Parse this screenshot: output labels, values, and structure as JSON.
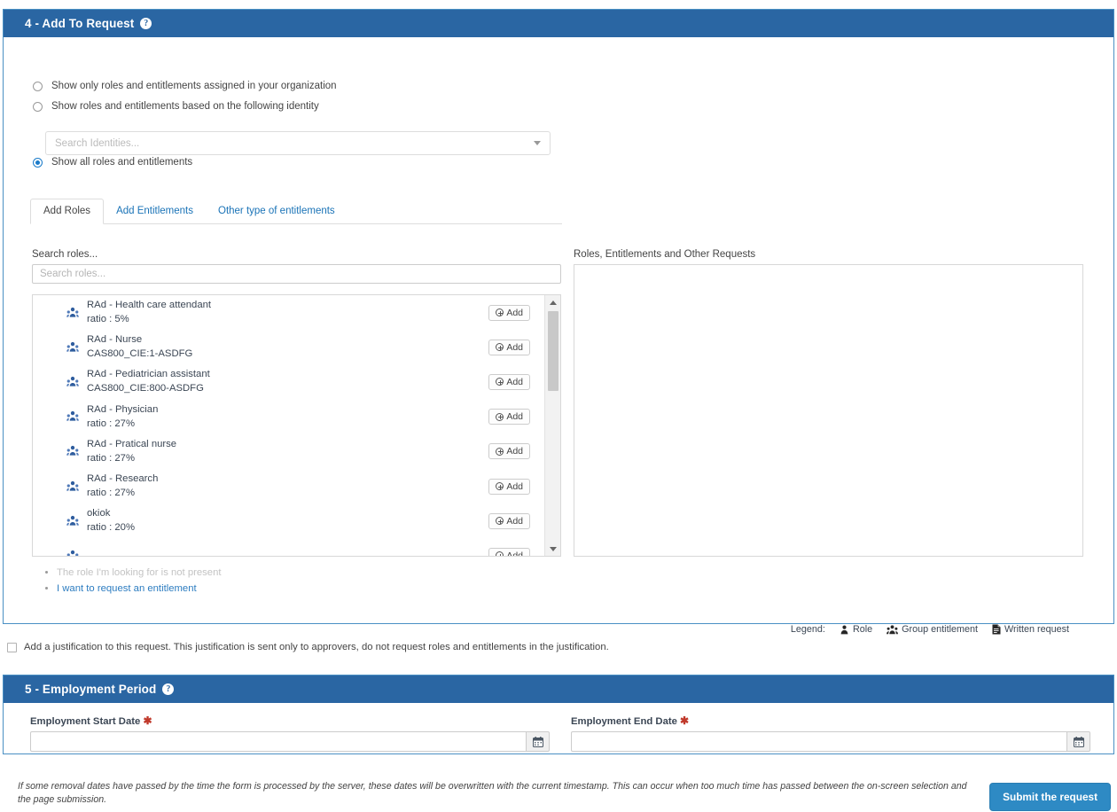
{
  "section4": {
    "title": "4 - Add To Request",
    "help_icon": "help-circle-icon",
    "scope_options": [
      {
        "label": "Show only roles and entitlements assigned in your organization",
        "selected": false
      },
      {
        "label": "Show roles and entitlements based on the following identity",
        "selected": false
      },
      {
        "label": "Show all roles and entitlements",
        "selected": true
      }
    ],
    "identity_select": {
      "placeholder": "Search Identities...",
      "value": "",
      "caret_icon": "chevron-down-icon"
    },
    "tabs": [
      {
        "label": "Add Roles",
        "active": true
      },
      {
        "label": "Add Entitlements",
        "active": false
      },
      {
        "label": "Other type of entitlements",
        "active": false
      }
    ],
    "left_column": {
      "label": "Search roles...",
      "search_placeholder": "Search roles...",
      "search_value": "",
      "add_button_label": "Add",
      "add_button_icon": "plus-circle-icon",
      "row_icon": "group-entitlement-icon",
      "roles": [
        {
          "name": "RAd - Health care attendant",
          "detail": "ratio : 5%"
        },
        {
          "name": "RAd - Nurse",
          "detail": "CAS800_CIE:1-ASDFG"
        },
        {
          "name": "RAd - Pediatrician assistant",
          "detail": "CAS800_CIE:800-ASDFG"
        },
        {
          "name": "RAd - Physician",
          "detail": "ratio : 27%"
        },
        {
          "name": "RAd - Pratical nurse",
          "detail": "ratio : 27%"
        },
        {
          "name": "RAd - Research",
          "detail": "ratio : 27%"
        },
        {
          "name": "okiok",
          "detail": "ratio : 20%"
        }
      ]
    },
    "right_column": {
      "label": "Roles, Entitlements and Other Requests",
      "items": []
    },
    "helper_links": [
      {
        "label": "The role I'm looking for is not present",
        "state": "disabled"
      },
      {
        "label": "I want to request an entitlement",
        "state": "link"
      }
    ],
    "legend": {
      "title": "Legend:",
      "items": [
        {
          "label": "Role",
          "icon": "role-person-icon"
        },
        {
          "label": "Group entitlement",
          "icon": "group-entitlement-icon"
        },
        {
          "label": "Written request",
          "icon": "written-request-icon"
        }
      ]
    }
  },
  "justification": {
    "checked": false,
    "label": "Add a justification to this request. This justification is sent only to approvers, do not request roles and entitlements in the justification."
  },
  "section5": {
    "title": "5 - Employment Period",
    "help_icon": "help-circle-icon",
    "start_date": {
      "label": "Employment Start Date",
      "required_marker": "✱",
      "value": "",
      "placeholder": "",
      "calendar_icon": "calendar-icon"
    },
    "end_date": {
      "label": "Employment End Date",
      "required_marker": "✱",
      "value": "",
      "placeholder": "",
      "calendar_icon": "calendar-icon"
    }
  },
  "footer": {
    "note": "If some removal dates have passed by the time the form is processed by the server, these dates will be overwritten with the current timestamp. This can occur when too much time has passed between the on-screen selection and the page submission.",
    "submit_label": "Submit the request"
  },
  "colors": {
    "panel_header_blue": "#2a66a3",
    "panel_border_blue": "#4a90c4",
    "link_blue": "#2c7cc0",
    "submit_blue": "#2e8ac4",
    "required_red": "#c0392b",
    "icon_blue": "#2f5d9e"
  }
}
